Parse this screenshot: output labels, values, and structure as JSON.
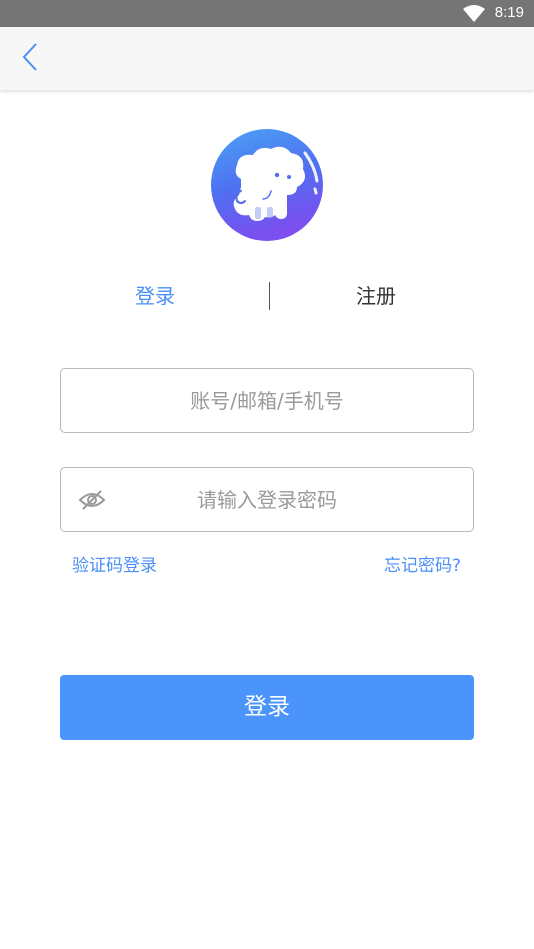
{
  "status_bar": {
    "time": "8:19",
    "wifi_icon": "wifi-icon"
  },
  "app_bar": {
    "back_icon": "chevron-left-icon"
  },
  "logo": {
    "icon": "elephant-logo-icon"
  },
  "tabs": {
    "login": "登录",
    "register": "注册",
    "active": "login"
  },
  "form": {
    "account_placeholder": "账号/邮箱/手机号",
    "account_value": "",
    "password_placeholder": "请输入登录密码",
    "password_value": "",
    "password_visibility_icon": "eye-off-icon"
  },
  "links": {
    "sms_login": "验证码登录",
    "forgot_password": "忘记密码?"
  },
  "submit": {
    "label": "登录"
  },
  "colors": {
    "accent": "#4a8ef7",
    "button": "#4a94fb",
    "status_bar": "#757575",
    "app_bar": "#f7f7f7"
  }
}
